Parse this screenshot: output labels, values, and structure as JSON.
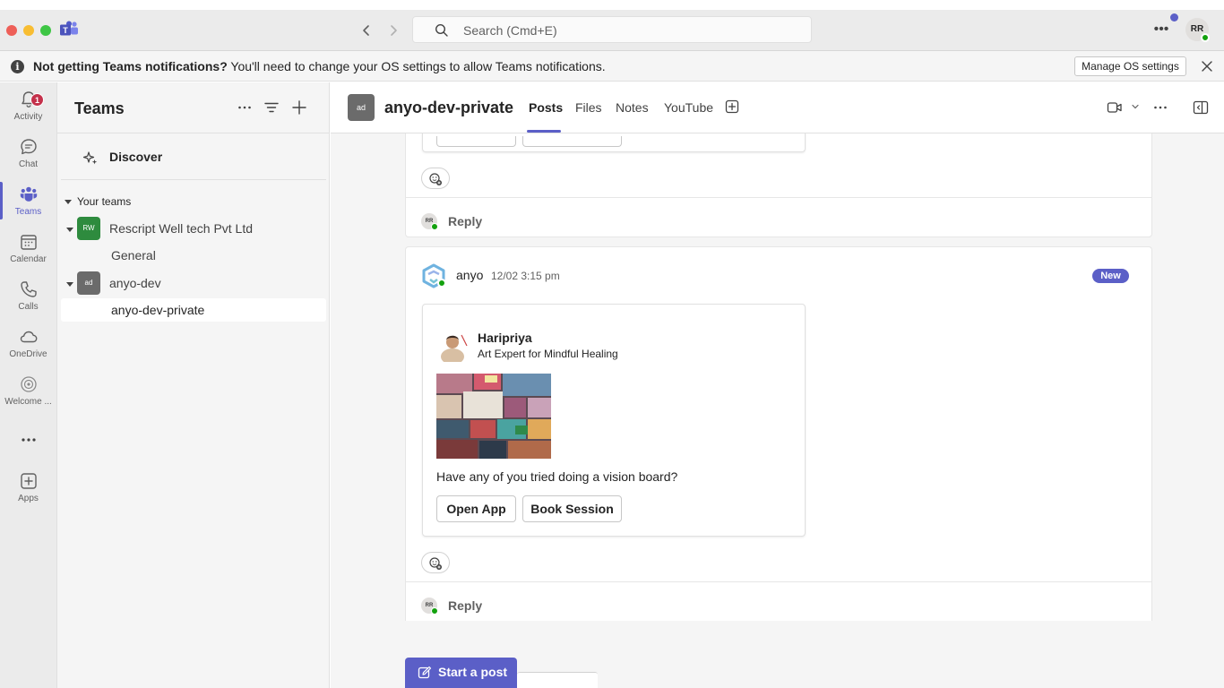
{
  "titlebar": {
    "search_placeholder": "Search (Cmd+E)",
    "user_initials": "RR"
  },
  "notification": {
    "bold_text": "Not getting Teams notifications?",
    "text": " You'll need to change your OS settings to allow Teams notifications.",
    "button_label": "Manage OS settings"
  },
  "rail": {
    "items": [
      {
        "label": "Activity",
        "badge": "1"
      },
      {
        "label": "Chat"
      },
      {
        "label": "Teams"
      },
      {
        "label": "Calendar"
      },
      {
        "label": "Calls"
      },
      {
        "label": "OneDrive"
      },
      {
        "label": "Welcome ..."
      },
      {
        "label": "Apps"
      }
    ],
    "active": "Teams"
  },
  "teams_panel": {
    "title": "Teams",
    "discover_label": "Discover",
    "section_label": "Your teams",
    "teams": [
      {
        "name": "Rescript Well tech Pvt Ltd",
        "initials": "RW",
        "color": "#2e8b3e",
        "channels": [
          "General"
        ]
      },
      {
        "name": "anyo-dev",
        "initials": "ad",
        "color": "#6b6b6b",
        "channels": [
          "anyo-dev-private"
        ]
      }
    ]
  },
  "channel": {
    "initials": "ad",
    "name": "anyo-dev-private",
    "tabs": [
      "Posts",
      "Files",
      "Notes",
      "YouTube"
    ],
    "active_tab": "Posts"
  },
  "posts": {
    "reply_label": "Reply",
    "reply_avatar": "RR",
    "second": {
      "author": "anyo",
      "timestamp": "12/02 3:15 pm",
      "badge": "New",
      "card": {
        "name": "Haripriya",
        "subtitle": "Art Expert for Mindful Healing",
        "message": "Have any of you tried doing a vision board?",
        "buttons": [
          "Open App",
          "Book Session"
        ]
      }
    }
  },
  "compose": {
    "start_post_label": "Start a post"
  },
  "colors": {
    "brand": "#5b5fc7",
    "rail_bg": "#ebebeb",
    "panel_bg": "#f5f5f5",
    "presence": "#13a10e"
  }
}
